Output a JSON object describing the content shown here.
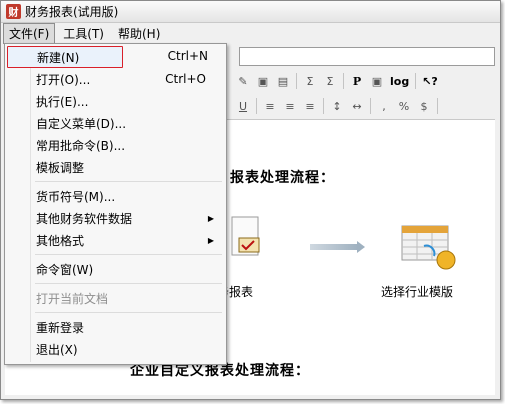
{
  "window": {
    "title": "财务报表(试用版)",
    "app_icon_glyph": "财"
  },
  "menubar": [
    {
      "label": "文件(F)",
      "active": true
    },
    {
      "label": "工具(T)",
      "active": false
    },
    {
      "label": "帮助(H)",
      "active": false
    }
  ],
  "file_menu": [
    {
      "label": "新建(N)",
      "shortcut": "Ctrl+N"
    },
    {
      "label": "打开(O)...",
      "shortcut": "Ctrl+O"
    },
    {
      "label": "执行(E)..."
    },
    {
      "label": "自定义菜单(D)..."
    },
    {
      "label": "常用批命令(B)..."
    },
    {
      "label": "模板调整"
    },
    {
      "label": "货币符号(M)..."
    },
    {
      "label": "其他财务软件数据",
      "submenu": true
    },
    {
      "label": "其他格式",
      "submenu": true
    },
    {
      "label": "命令窗(W)"
    },
    {
      "label": "打开当前文档",
      "disabled": true
    },
    {
      "label": "重新登录"
    },
    {
      "label": "退出(X)"
    }
  ],
  "toolbar1": [
    "Σ",
    "Σ",
    "P",
    "log"
  ],
  "toolbar2": [
    "U",
    "≡",
    "≡",
    "≡",
    "↕",
    "↔",
    ",",
    "%",
    "$"
  ],
  "content": {
    "heading1": "报表处理流程：",
    "caption1": "务报表",
    "caption2": "选择行业模版",
    "heading2": "企业自定义报表处理流程："
  },
  "colors": {
    "highlight_box": "#d9202a",
    "app_icon": "#c0392b"
  }
}
